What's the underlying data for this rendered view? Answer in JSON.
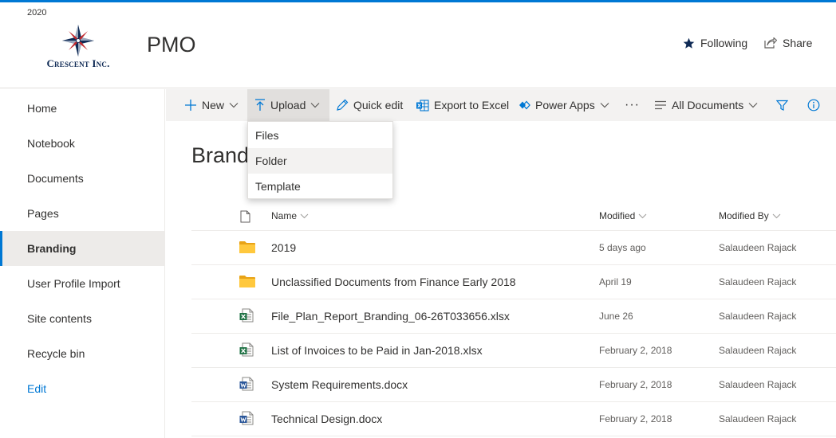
{
  "header": {
    "year": "2020",
    "logo_text": "Crescent Inc.",
    "site_title": "PMO",
    "following_label": "Following",
    "share_label": "Share"
  },
  "leftnav": {
    "items": [
      {
        "label": "Home"
      },
      {
        "label": "Notebook"
      },
      {
        "label": "Documents"
      },
      {
        "label": "Pages"
      },
      {
        "label": "Branding",
        "active": true
      },
      {
        "label": "User Profile Import"
      },
      {
        "label": "Site contents"
      },
      {
        "label": "Recycle bin"
      }
    ],
    "edit_label": "Edit"
  },
  "commandbar": {
    "new_label": "New",
    "upload_label": "Upload",
    "quick_edit_label": "Quick edit",
    "export_label": "Export to Excel",
    "power_apps_label": "Power Apps",
    "more_label": "···",
    "view_label": "All Documents"
  },
  "upload_menu": {
    "items": [
      "Files",
      "Folder",
      "Template"
    ],
    "highlighted": "Folder"
  },
  "library": {
    "heading": "Brand",
    "columns": {
      "name": "Name",
      "modified": "Modified",
      "modified_by": "Modified By"
    },
    "rows": [
      {
        "type": "folder",
        "name": "2019",
        "modified": "5 days ago",
        "modified_by": "Salaudeen Rajack"
      },
      {
        "type": "folder",
        "name": "Unclassified Documents from Finance Early 2018",
        "modified": "April 19",
        "modified_by": "Salaudeen Rajack"
      },
      {
        "type": "excel",
        "name": "File_Plan_Report_Branding_06-26T033656.xlsx",
        "modified": "June 26",
        "modified_by": "Salaudeen Rajack"
      },
      {
        "type": "excel",
        "name": "List of Invoices to be Paid in Jan-2018.xlsx",
        "modified": "February 2, 2018",
        "modified_by": "Salaudeen Rajack"
      },
      {
        "type": "word",
        "name": "System Requirements.docx",
        "modified": "February 2, 2018",
        "modified_by": "Salaudeen Rajack"
      },
      {
        "type": "word",
        "name": "Technical Design.docx",
        "modified": "February 2, 2018",
        "modified_by": "Salaudeen Rajack"
      }
    ]
  },
  "colors": {
    "accent": "#0078d4",
    "folder": "#ffc83d",
    "excel": "#217346",
    "word": "#2b579a",
    "logo_navy": "#0f2a55",
    "logo_red": "#c0282d"
  }
}
